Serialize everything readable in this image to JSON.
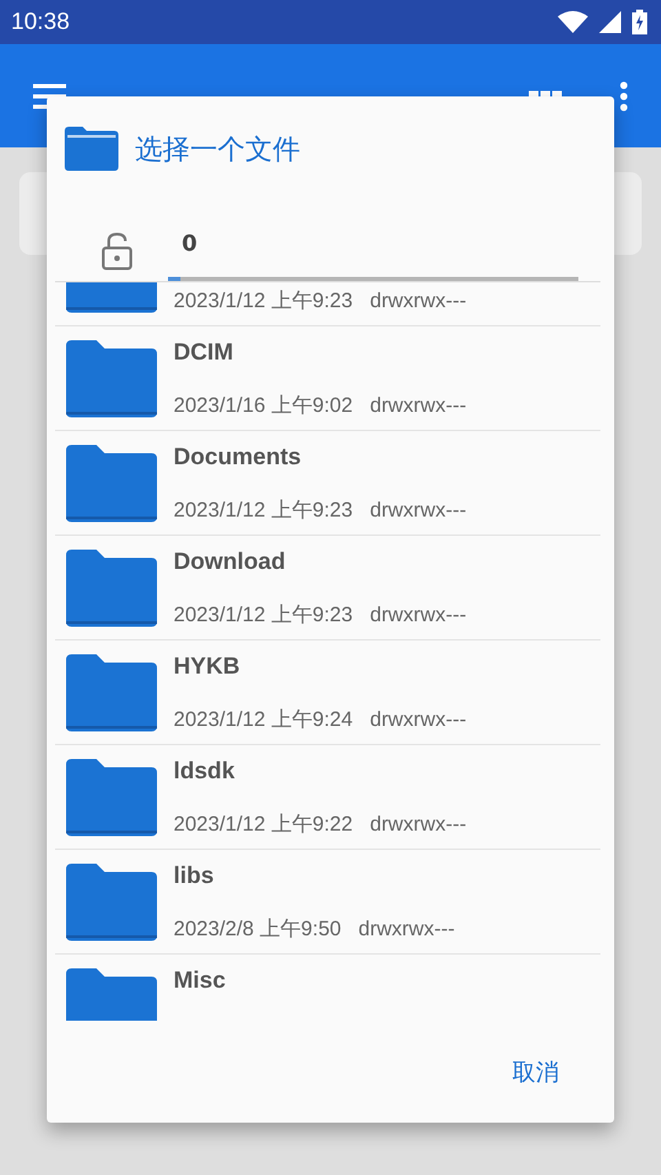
{
  "status_bar": {
    "time": "10:38"
  },
  "dialog": {
    "title": "选择一个文件",
    "path": {
      "text": "0",
      "level": 0.03
    },
    "files": [
      {
        "date": "2023/1/12 上午9:23",
        "perms": "drwxrwx---"
      },
      {
        "name": "DCIM",
        "date": "2023/1/16 上午9:02",
        "perms": "drwxrwx---"
      },
      {
        "name": "Documents",
        "date": "2023/1/12 上午9:23",
        "perms": "drwxrwx---"
      },
      {
        "name": "Download",
        "date": "2023/1/12 上午9:23",
        "perms": "drwxrwx---"
      },
      {
        "name": "HYKB",
        "date": "2023/1/12 上午9:24",
        "perms": "drwxrwx---"
      },
      {
        "name": "ldsdk",
        "date": "2023/1/12 上午9:22",
        "perms": "drwxrwx---"
      },
      {
        "name": "libs",
        "date": "2023/2/8 上午9:50",
        "perms": "drwxrwx---"
      },
      {
        "name": "Misc"
      }
    ],
    "cancel": "取消"
  }
}
